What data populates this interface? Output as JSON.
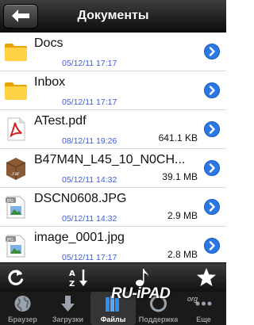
{
  "navbar": {
    "title": "Документы",
    "back_icon": "back-arrow-icon"
  },
  "files": [
    {
      "name": "Docs",
      "date": "05/12/11 17:17",
      "size": "",
      "icon": "folder-icon"
    },
    {
      "name": "Inbox",
      "date": "05/12/11 17:17",
      "size": "",
      "icon": "folder-icon"
    },
    {
      "name": "ATest.pdf",
      "date": "08/12/11 19:26",
      "size": "641.1 KB",
      "icon": "pdf-icon"
    },
    {
      "name": "B47M4N_L45_10_N0CH...",
      "date": "05/12/11 14:32",
      "size": "39.1 MB",
      "icon": "rar-icon"
    },
    {
      "name": "DSCN0608.JPG",
      "date": "05/12/11 14:32",
      "size": "2.9 MB",
      "icon": "jpg-icon"
    },
    {
      "name": "image_0001.jpg",
      "date": "05/12/11 17:17",
      "size": "2.8 MB",
      "icon": "jpg-icon"
    }
  ],
  "toolbar": {
    "refresh_icon": "refresh-icon",
    "sort_icon": "sort-az-icon",
    "music_icon": "music-note-icon",
    "favorites_icon": "star-icon"
  },
  "tabs": [
    {
      "label": "Браузер",
      "icon": "globe-icon",
      "active": false
    },
    {
      "label": "Загрузки",
      "icon": "download-arrow-icon",
      "active": false
    },
    {
      "label": "Файлы",
      "icon": "files-icon",
      "active": true
    },
    {
      "label": "Поддержка",
      "icon": "support-icon",
      "active": false
    },
    {
      "label": "Еще",
      "icon": "more-icon",
      "active": false
    }
  ],
  "watermark": {
    "text": "RU-iPAD",
    "sub": "org"
  },
  "colors": {
    "date": "#3f5bd6",
    "disclosure": "#2a78e4",
    "navbar": "#1c1c1c"
  }
}
